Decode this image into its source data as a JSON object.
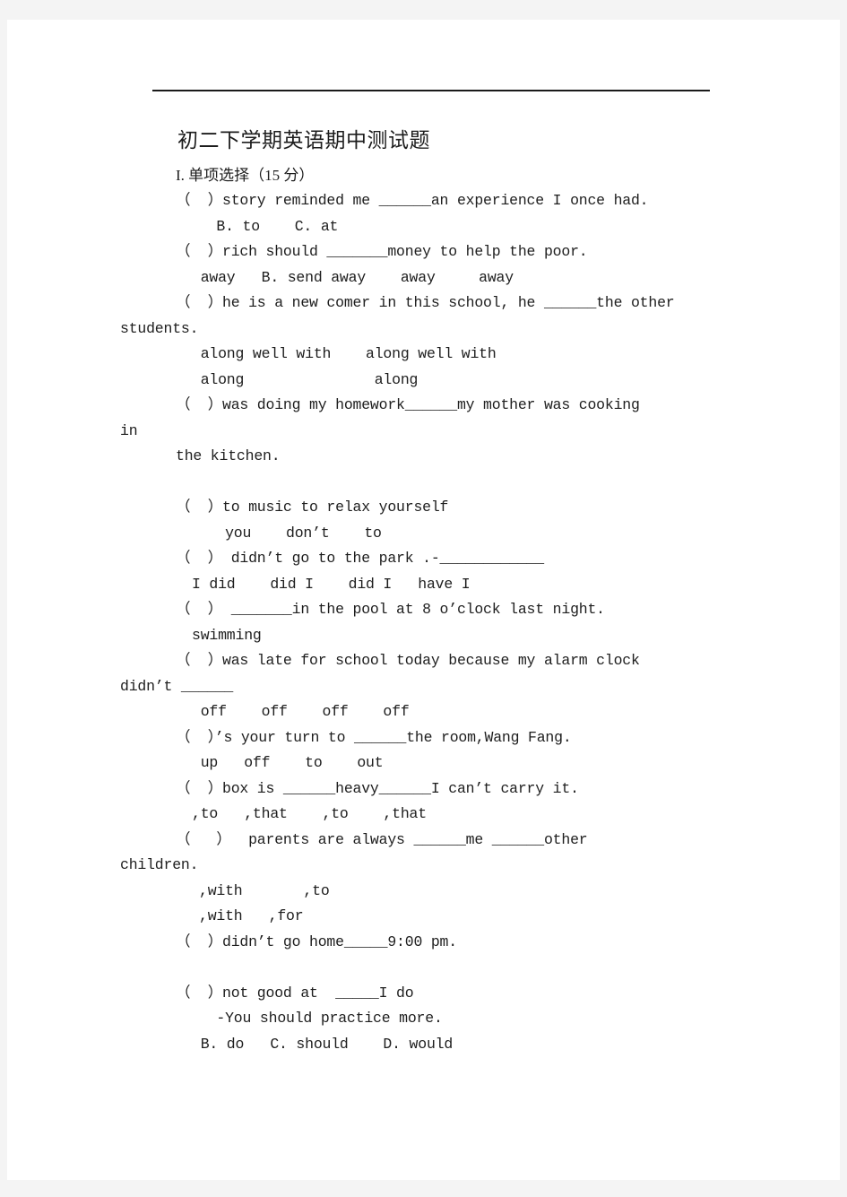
{
  "page": {
    "background_color": "#f4f4f4",
    "paper_color": "#ffffff",
    "text_color": "#1d1d1d",
    "rule_color": "#1a1a1a"
  },
  "document": {
    "title": "初二下学期英语期中测试题",
    "section_heading": "I. 单项选择（15 分）",
    "lines": [
      {
        "id": "q1",
        "kind": "question",
        "text": "（  ）story reminded me ______an experience I once had."
      },
      {
        "id": "q1-opts",
        "kind": "options",
        "text": "  B. to    C. at"
      },
      {
        "id": "q2",
        "kind": "question",
        "text": "（  ）rich should _______money to help the poor."
      },
      {
        "id": "q2-opts",
        "kind": "options",
        "text": " away   B. send away    away     away"
      },
      {
        "id": "q3",
        "kind": "question",
        "text": "（  ）he is a new comer in this school, he ______the other"
      },
      {
        "id": "q3-wrap",
        "kind": "continuation",
        "text": "students."
      },
      {
        "id": "q3-optsA",
        "kind": "options",
        "text": " along well with    along well with"
      },
      {
        "id": "q3-optsB",
        "kind": "options",
        "text": " along               along"
      },
      {
        "id": "q4",
        "kind": "question",
        "text": "（  ）was doing my homework______my mother was cooking"
      },
      {
        "id": "q4-wrap",
        "kind": "continuation",
        "text": "in"
      },
      {
        "id": "q4-wrap2",
        "kind": "continuation",
        "text": "the kitchen."
      },
      {
        "id": "gap1",
        "kind": "blank",
        "text": ""
      },
      {
        "id": "q5",
        "kind": "question",
        "text": "（  ）to music to relax yourself"
      },
      {
        "id": "q5-opts",
        "kind": "options",
        "text": "   you    don’t    to"
      },
      {
        "id": "q6",
        "kind": "question",
        "text": "（  ） didn’t go to the park .-____________"
      },
      {
        "id": "q6-opts",
        "kind": "options",
        "text": "I did    did I    did I   have I"
      },
      {
        "id": "q7",
        "kind": "question",
        "text": "（  ） _______in the pool at 8 o’clock last night."
      },
      {
        "id": "q7-opts",
        "kind": "options",
        "text": "swimming"
      },
      {
        "id": "q8",
        "kind": "question",
        "text": "（  ）was late for school today because my alarm clock"
      },
      {
        "id": "q8-wrap",
        "kind": "continuation",
        "text": "didn’t ______"
      },
      {
        "id": "q8-opts",
        "kind": "options",
        "text": " off    off    off    off"
      },
      {
        "id": "q9",
        "kind": "question",
        "text": "（  ）’s your turn to ______the room,Wang Fang."
      },
      {
        "id": "q9-opts",
        "kind": "options",
        "text": " up   off    to    out"
      },
      {
        "id": "q10",
        "kind": "question",
        "text": "（  ）box is ______heavy______I can’t carry it."
      },
      {
        "id": "q10-opts",
        "kind": "options",
        "text": ",to   ,that    ,to    ,that"
      },
      {
        "id": "q11",
        "kind": "question",
        "text": "（   ）  parents are always ______me ______other"
      },
      {
        "id": "q11-wrap",
        "kind": "continuation",
        "text": "children."
      },
      {
        "id": "q11-optsA",
        "kind": "options",
        "text": ",with       ,to"
      },
      {
        "id": "q11-optsB",
        "kind": "options",
        "text": ",with   ,for"
      },
      {
        "id": "q12",
        "kind": "question",
        "text": "（  ）didn’t go home_____9:00 pm."
      },
      {
        "id": "gap2",
        "kind": "blank",
        "text": ""
      },
      {
        "id": "q13",
        "kind": "question",
        "text": "（  ）not good at  _____I do"
      },
      {
        "id": "q13-b",
        "kind": "options",
        "text": "  -You should practice more."
      },
      {
        "id": "q13-opts",
        "kind": "options",
        "text": " B. do   C. should    D. would"
      }
    ]
  }
}
